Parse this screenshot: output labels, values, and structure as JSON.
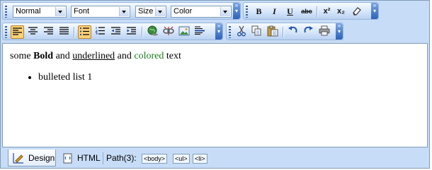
{
  "toolbar": {
    "format_select": "Normal",
    "font_select": "Font",
    "size_select": "Size",
    "color_select": "Color",
    "bold_label": "B",
    "italic_label": "I",
    "underline_label": "U",
    "strike_label": "abc",
    "superscript_label": "x²",
    "subscript_label": "x₂"
  },
  "content": {
    "text_prefix": "some ",
    "bold_text": "Bold",
    "text_and1": " and ",
    "underlined_text": "underlined",
    "text_and2": " and ",
    "colored_text": "colored",
    "text_suffix": " text",
    "colored_color": "#1a7a1a",
    "list_items": [
      "bulleted list 1"
    ]
  },
  "status": {
    "design_tab": "Design",
    "html_tab": "HTML",
    "path_label": "Path(3):",
    "path_tags": [
      "<body>",
      "<ul>",
      "<li>"
    ]
  },
  "colors": {
    "chrome_background": "#c7dcf6",
    "active_button": "#ffd27a"
  }
}
